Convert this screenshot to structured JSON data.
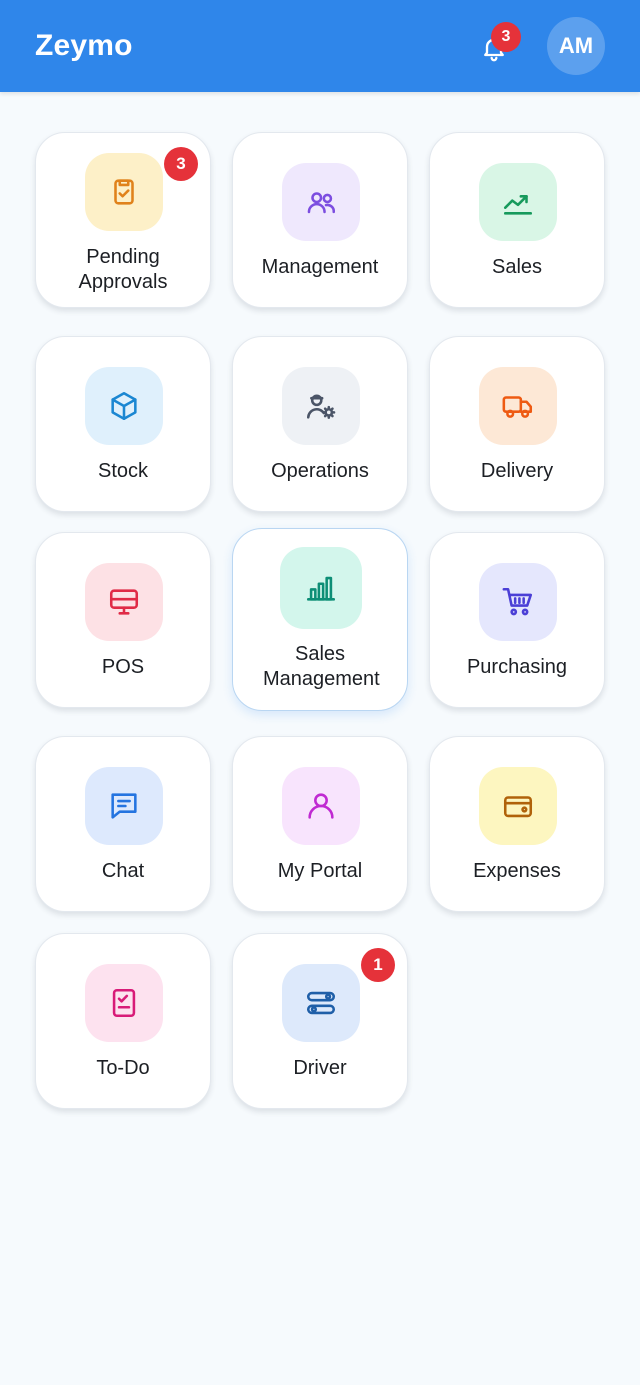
{
  "header": {
    "brand": "Zeymo",
    "notification_count": "3",
    "avatar_initials": "AM",
    "background_color": "#2f86ea"
  },
  "tiles": [
    {
      "label": "Pending Approvals",
      "badge": "3",
      "icon": "clipboard-check-icon",
      "color": "#e0821b",
      "bg": "#fdf0c8"
    },
    {
      "label": "Management",
      "icon": "users-icon",
      "color": "#7c4de0",
      "bg": "#efe8fd"
    },
    {
      "label": "Sales",
      "icon": "trend-up-icon",
      "color": "#179a5c",
      "bg": "#d9f6e6"
    },
    {
      "label": "Stock",
      "icon": "box-icon",
      "color": "#1b87d2",
      "bg": "#dff0fc"
    },
    {
      "label": "Operations",
      "icon": "user-gear-icon",
      "color": "#4b5567",
      "bg": "#eef1f5"
    },
    {
      "label": "Delivery",
      "icon": "truck-icon",
      "color": "#ee5a12",
      "bg": "#fde8d6"
    },
    {
      "label": "POS",
      "icon": "monitor-icon",
      "color": "#e02a46",
      "bg": "#fde1e5"
    },
    {
      "label": "Sales Management",
      "icon": "bar-chart-icon",
      "color": "#0d8e76",
      "bg": "#d3f6ec"
    },
    {
      "label": "Purchasing",
      "icon": "cart-icon",
      "color": "#4b3fd6",
      "bg": "#e5e7fd"
    },
    {
      "label": "Chat",
      "icon": "chat-icon",
      "color": "#2474e0",
      "bg": "#dde9fd"
    },
    {
      "label": "My Portal",
      "icon": "user-icon",
      "color": "#c02ad2",
      "bg": "#f8e4fd"
    },
    {
      "label": "Expenses",
      "icon": "wallet-icon",
      "color": "#b0620a",
      "bg": "#fdf6c0"
    },
    {
      "label": "To-Do",
      "icon": "checklist-icon",
      "color": "#d81b78",
      "bg": "#fde2ef"
    },
    {
      "label": "Driver",
      "badge": "1",
      "icon": "route-icon",
      "color": "#1f5fa8",
      "bg": "#dde9fb"
    }
  ]
}
